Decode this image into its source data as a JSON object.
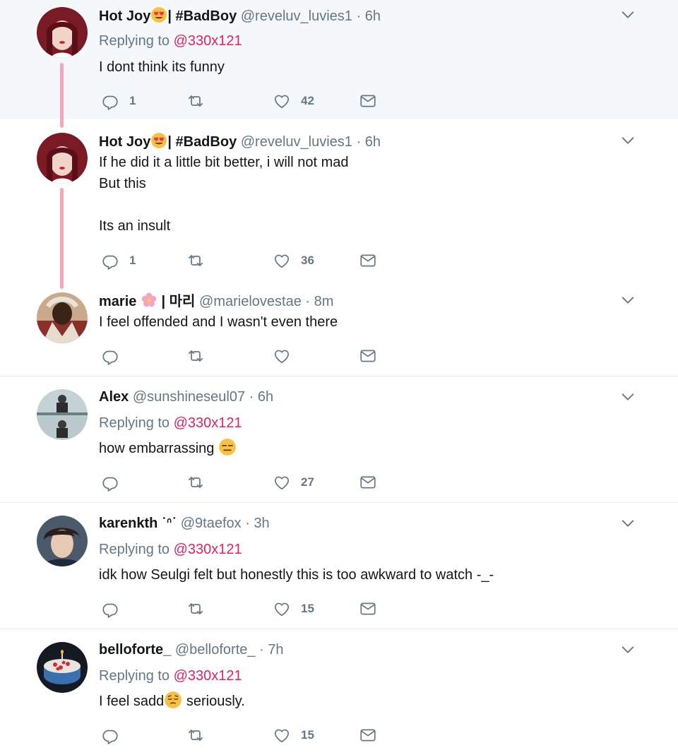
{
  "tweets": [
    {
      "name": "Hot Joy",
      "name_suffix": "| #BadBoy",
      "handle": "@reveluv_luvies1",
      "sep": "·",
      "time": "6h",
      "replying_label": "Replying to",
      "replying_to": "@330x121",
      "body": [
        "I dont think its funny"
      ],
      "replies": "1",
      "retweets": "",
      "likes": "42",
      "avatar_bg": "#d9a8a8"
    },
    {
      "name": "Hot Joy",
      "name_suffix": "| #BadBoy",
      "handle": "@reveluv_luvies1",
      "sep": "·",
      "time": "6h",
      "body": [
        "If he did it a little bit better, i will not mad",
        "But this",
        "",
        "Its an insult"
      ],
      "replies": "1",
      "retweets": "",
      "likes": "36",
      "avatar_bg": "#d9a8a8"
    },
    {
      "name": "marie",
      "name_suffix": "| 마리",
      "handle": "@marielovestae",
      "sep": "·",
      "time": "8m",
      "body": [
        "I feel offended and I wasn't even there"
      ],
      "replies": "",
      "retweets": "",
      "likes": "",
      "avatar_bg": "#6b4a3a"
    },
    {
      "name": "Alex",
      "handle": "@sunshineseul07",
      "sep": "·",
      "time": "6h",
      "replying_label": "Replying to",
      "replying_to": "@330x121",
      "body": [
        "how embarrassing"
      ],
      "replies": "",
      "retweets": "",
      "likes": "27",
      "avatar_bg": "#9fb3b8"
    },
    {
      "name": "karenkth",
      "name_suffix": "˙ᐢ˙",
      "handle": "@9taefox",
      "sep": "·",
      "time": "3h",
      "replying_label": "Replying to",
      "replying_to": "@330x121",
      "body": [
        "idk how Seulgi felt but honestly this is too awkward to watch -_-"
      ],
      "replies": "",
      "retweets": "",
      "likes": "15",
      "avatar_bg": "#2d3a4a"
    },
    {
      "name": "belloforte_",
      "handle": "@belloforte_",
      "sep": "·",
      "time": "7h",
      "replying_label": "Replying to",
      "replying_to": "@330x121",
      "body_pre": "I feel sadd",
      "body_post": " seriously.",
      "replies": "",
      "retweets": "",
      "likes": "15",
      "avatar_bg": "#1d2430"
    }
  ],
  "colors": {
    "mention": "#e0245e",
    "secondary": "#657786",
    "thread_line": "#f4a7b9",
    "highlight_bg": "#f5f8fa",
    "divider": "#e6ecf0"
  },
  "icons": [
    "reply-icon",
    "retweet-icon",
    "like-icon",
    "dm-icon",
    "chevron-down-icon"
  ]
}
